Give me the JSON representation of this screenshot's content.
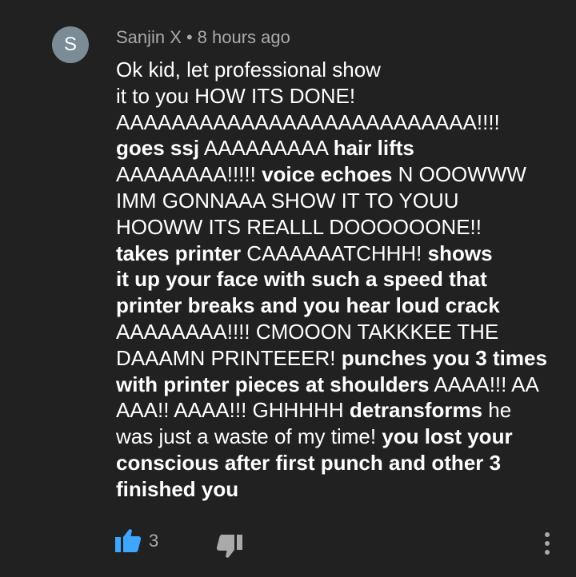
{
  "colors": {
    "background": "#212121",
    "accent": "#3ea6ff",
    "muted": "#aaaaaa",
    "avatar_bg": "#7b8c96"
  },
  "comment": {
    "avatar_letter": "S",
    "author": "Sanjin X",
    "separator": "•",
    "timestamp": "8 hours ago",
    "lines": [
      [
        {
          "t": "Ok kid, let professional show"
        }
      ],
      [
        {
          "t": "it to you HOW ITS DONE!"
        }
      ],
      [
        {
          "t": "AAAAAAAAAAAAAAAAAAAAAAAAAA!!!!"
        }
      ],
      [
        {
          "t": "goes ssj",
          "b": true
        },
        {
          "t": " AAAAAAAAA "
        },
        {
          "t": "hair lifts",
          "b": true
        }
      ],
      [
        {
          "t": "AAAAAAAA!!!!! "
        },
        {
          "t": "voice echoes",
          "b": true
        },
        {
          "t": " N OOOWWW"
        }
      ],
      [
        {
          "t": "IMM GONNAAA SHOW IT TO YOUU"
        }
      ],
      [
        {
          "t": "HOOWW ITS REALLL DOOOOOONE!!"
        }
      ],
      [
        {
          "t": "takes printer",
          "b": true
        },
        {
          "t": " CAAAAAATCHHH! "
        },
        {
          "t": "shows",
          "b": true
        }
      ],
      [
        {
          "t": "it up your face with such a speed that",
          "b": true
        }
      ],
      [
        {
          "t": "printer breaks and you hear loud crack",
          "b": true
        }
      ],
      [
        {
          "t": "AAAAAAAA!!!! CMOOON TAKKKEE THE"
        }
      ],
      [
        {
          "t": "DAAAMN PRINTEEER! "
        },
        {
          "t": "punches you 3 times",
          "b": true
        }
      ],
      [
        {
          "t": "with printer pieces at shoulders",
          "b": true
        },
        {
          "t": " AAAA!!! AA"
        }
      ],
      [
        {
          "t": "AAA!! AAAA!!! GHHHHH "
        },
        {
          "t": "detransforms",
          "b": true
        },
        {
          "t": " he"
        }
      ],
      [
        {
          "t": "was just a waste of my time! "
        },
        {
          "t": "you lost your",
          "b": true
        }
      ],
      [
        {
          "t": "conscious after first punch and other 3",
          "b": true
        }
      ],
      [
        {
          "t": "finished you",
          "b": true
        }
      ]
    ],
    "like_count": "3"
  },
  "icons": {
    "like": "thumbs-up-icon",
    "dislike": "thumbs-down-icon",
    "more": "more-vertical-icon"
  }
}
